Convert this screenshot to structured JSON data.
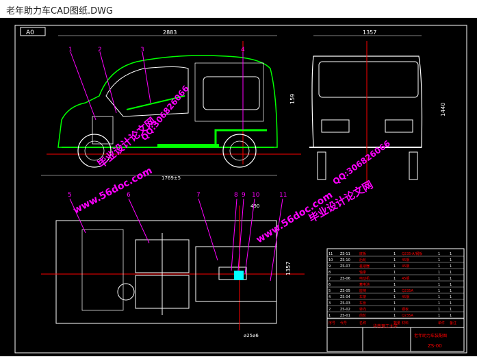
{
  "window": {
    "title": "老年助力车CAD图纸.DWG"
  },
  "sheet": {
    "size_label": "A0"
  },
  "dims": {
    "front_width": "2883",
    "side_width": "1357",
    "front_height": "159",
    "side_height": "1440",
    "wheelbase": "1769±5",
    "top_offset": "490",
    "top_height": "1357",
    "bottom_dim": "⌀25⌀6"
  },
  "callouts": [
    "1",
    "2",
    "3",
    "4",
    "5",
    "6",
    "7",
    "8",
    "9",
    "10",
    "11"
  ],
  "watermarks": {
    "site_1": "www.56doc.com",
    "qq_1": "QQ:306826066",
    "name_1": "毕业设计论文网",
    "site_2": "www.56doc.com",
    "qq_2": "QQ:306826066",
    "name_2": "毕业设计论文网"
  },
  "bom": {
    "rows": [
      {
        "no": "11",
        "code": "ZS-11",
        "name": "底板",
        "qty": "1",
        "mat": "Q235-A/钢板",
        "c1": "1",
        "c2": "1"
      },
      {
        "no": "10",
        "code": "ZS-10",
        "name": "后轮",
        "qty": "1",
        "mat": "45钢",
        "c1": "1",
        "c2": "1"
      },
      {
        "no": "9",
        "code": "ZS-07",
        "name": "差速器",
        "qty": "1",
        "mat": "45钢",
        "c1": "1",
        "c2": "1"
      },
      {
        "no": "8",
        "code": "",
        "name": "轴承",
        "qty": "1",
        "mat": "",
        "c1": "1",
        "c2": "1"
      },
      {
        "no": "7",
        "code": "ZS-06",
        "name": "电动机",
        "qty": "1",
        "mat": "45钢",
        "c1": "1",
        "c2": "1"
      },
      {
        "no": "6",
        "code": "",
        "name": "蓄电池",
        "qty": "1",
        "mat": "",
        "c1": "1",
        "c2": "1"
      },
      {
        "no": "5",
        "code": "ZS-05",
        "name": "座椅",
        "qty": "1",
        "mat": "Q235A",
        "c1": "1",
        "c2": "1"
      },
      {
        "no": "4",
        "code": "ZS-04",
        "name": "车架",
        "qty": "1",
        "mat": "45钢",
        "c1": "1",
        "c2": "1"
      },
      {
        "no": "3",
        "code": "ZS-03",
        "name": "车身",
        "qty": "1",
        "mat": "",
        "c1": "1",
        "c2": "1"
      },
      {
        "no": "2",
        "code": "ZS-02",
        "name": "转向",
        "qty": "1",
        "mat": "钢板",
        "c1": "1",
        "c2": "1"
      },
      {
        "no": "1",
        "code": "ZS-01",
        "name": "前轮",
        "qty": "1",
        "mat": "Q235A",
        "c1": "1",
        "c2": "1"
      }
    ],
    "header": {
      "no": "序号",
      "code": "代号",
      "name": "名称",
      "qty": "数量",
      "mat": "材料",
      "c1": "单件",
      "c2": "备注"
    },
    "title_block": {
      "school": "华南理工大学",
      "drawing_name": "老年助力车装配图",
      "drawing_no": "ZS-00"
    }
  },
  "colors": {
    "green": "#00ff00",
    "magenta": "#ff00ff",
    "red": "#ff0000",
    "cyan": "#00ffff",
    "white": "#ffffff",
    "yellow": "#ffff00"
  }
}
